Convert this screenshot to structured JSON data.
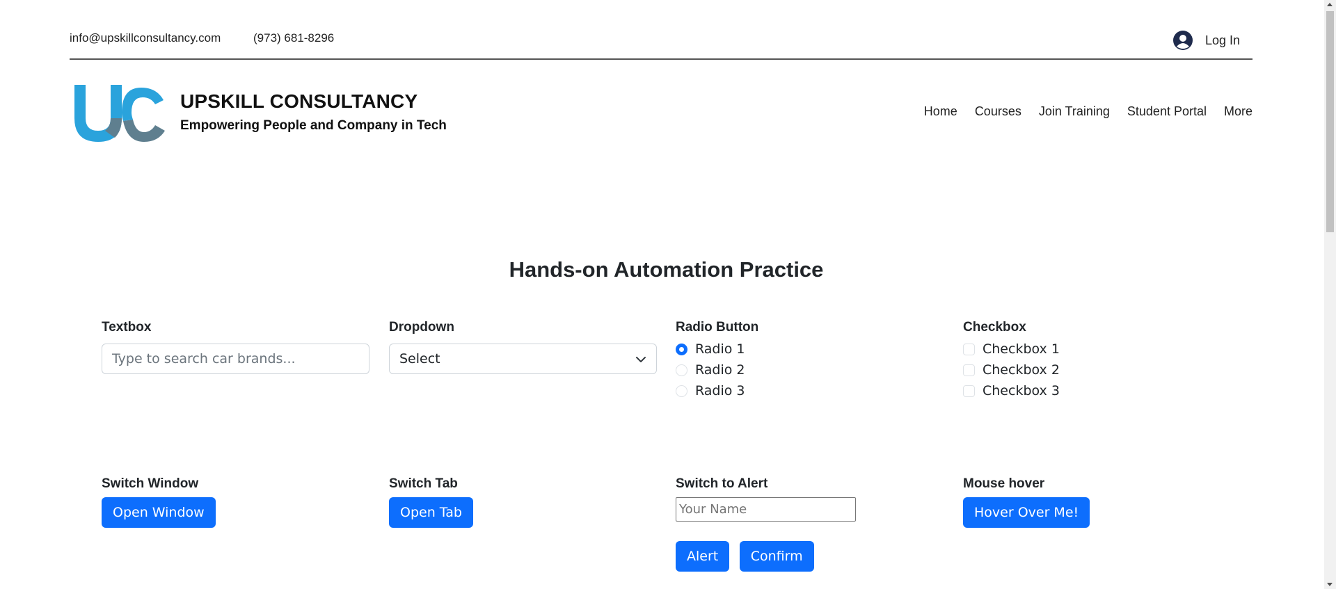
{
  "topbar": {
    "email": "info@upskillconsultancy.com",
    "phone": "(973) 681-8296",
    "login_label": "Log In"
  },
  "brand": {
    "title": "UPSKILL CONSULTANCY",
    "tagline": "Empowering People and Company in Tech",
    "logo_colors": {
      "blue": "#2aa3dc",
      "gray": "#5f7f8f"
    }
  },
  "nav": {
    "items": [
      "Home",
      "Courses",
      "Join Training",
      "Student Portal",
      "More"
    ]
  },
  "main": {
    "heading": "Hands-on Automation Practice",
    "textbox": {
      "label": "Textbox",
      "placeholder": "Type to search car brands...",
      "value": ""
    },
    "dropdown": {
      "label": "Dropdown",
      "selected": "Select"
    },
    "radio": {
      "label": "Radio Button",
      "options": [
        "Radio 1",
        "Radio 2",
        "Radio 3"
      ],
      "checked": "Radio 1"
    },
    "checkbox": {
      "label": "Checkbox",
      "options": [
        "Checkbox 1",
        "Checkbox 2",
        "Checkbox 3"
      ]
    },
    "switch_window": {
      "label": "Switch Window",
      "button": "Open Window"
    },
    "switch_tab": {
      "label": "Switch Tab",
      "button": "Open Tab"
    },
    "switch_alert": {
      "label": "Switch to Alert",
      "placeholder": "Your Name",
      "alert_button": "Alert",
      "confirm_button": "Confirm"
    },
    "mouse_hover": {
      "label": "Mouse hover",
      "button": "Hover Over Me!"
    }
  },
  "colors": {
    "primary": "#0d6efd"
  }
}
